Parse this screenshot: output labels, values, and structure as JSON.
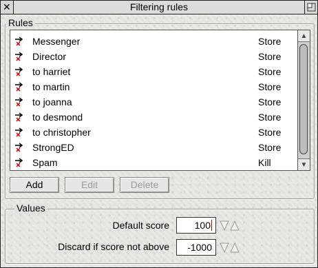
{
  "window": {
    "title": "Filtering rules"
  },
  "rules_group": {
    "label": "Rules"
  },
  "rules": [
    {
      "name": "Messenger",
      "action": "Store"
    },
    {
      "name": "Director",
      "action": "Store"
    },
    {
      "name": "to harriet",
      "action": "Store"
    },
    {
      "name": "to martin",
      "action": "Store"
    },
    {
      "name": "to joanna",
      "action": "Store"
    },
    {
      "name": "to desmond",
      "action": "Store"
    },
    {
      "name": "to christopher",
      "action": "Store"
    },
    {
      "name": "StrongED",
      "action": "Store"
    },
    {
      "name": "Spam",
      "action": "Kill"
    }
  ],
  "buttons": {
    "add": "Add",
    "edit": "Edit",
    "delete": "Delete"
  },
  "values_group": {
    "label": "Values"
  },
  "values": {
    "default_score_label": "Default score",
    "default_score": "100",
    "discard_label": "Discard if score not above",
    "discard": "-1000"
  },
  "icons": {
    "rule": "rule-arrow-icon",
    "close": "close-icon",
    "toggle": "toggle-size-icon",
    "adjuster": "up-down-adjuster-icon"
  },
  "colors": {
    "rule_icon_x": "#cc0000",
    "caret": "#cc0000"
  }
}
